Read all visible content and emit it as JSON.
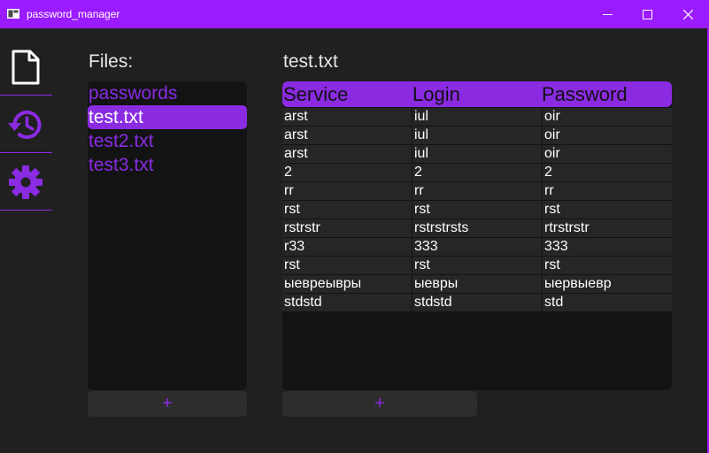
{
  "window": {
    "title": "password_manager"
  },
  "sidebar": {
    "items": [
      {
        "name": "files",
        "icon": "file-icon"
      },
      {
        "name": "history",
        "icon": "history-icon"
      },
      {
        "name": "settings",
        "icon": "gear-icon"
      }
    ]
  },
  "files_panel": {
    "label": "Files:",
    "items": [
      "passwords",
      "test.txt",
      "test2.txt",
      "test3.txt"
    ],
    "selected": "test.txt",
    "add_label": "+"
  },
  "table_panel": {
    "title": "test.txt",
    "columns": [
      "Service",
      "Login",
      "Password"
    ],
    "rows": [
      [
        "arst",
        "iul",
        "oir"
      ],
      [
        "arst",
        "iul",
        "oir"
      ],
      [
        "arst",
        "iul",
        "oir"
      ],
      [
        "2",
        "2",
        "2"
      ],
      [
        "rr",
        "rr",
        "rr"
      ],
      [
        "rst",
        "rst",
        "rst"
      ],
      [
        "rstrstr",
        "rstrstrsts",
        "rtrstrstr"
      ],
      [
        "r33",
        "333",
        "333"
      ],
      [
        "rst",
        "rst",
        "rst"
      ],
      [
        "ыевреывры",
        "ыевры",
        "ыервыевр"
      ],
      [
        "stdstd",
        "stdstd",
        "std"
      ]
    ],
    "add_label": "+"
  },
  "colors": {
    "accent": "#8a2be2",
    "titlebar": "#9b1bff",
    "background": "#202020",
    "panel": "#131313",
    "cell": "#262626"
  }
}
